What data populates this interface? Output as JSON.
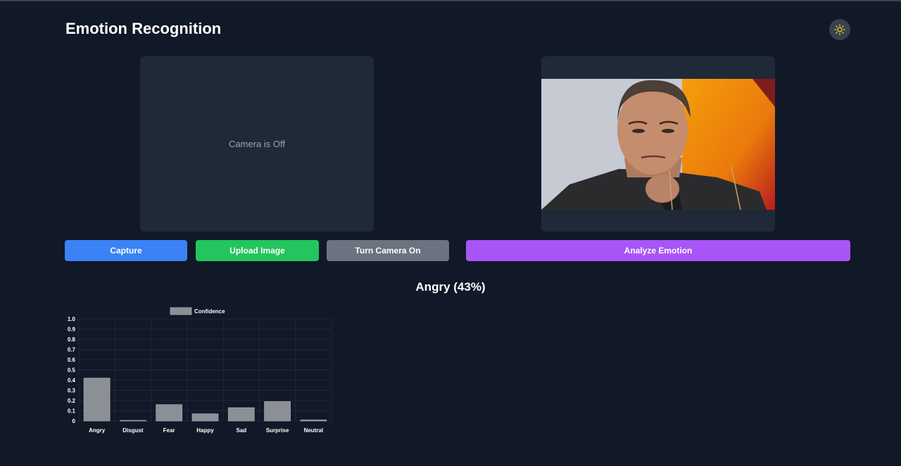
{
  "app": {
    "title": "Emotion Recognition",
    "theme_toggle_icon": "sun-icon"
  },
  "camera": {
    "status_text": "Camera is Off"
  },
  "toolbar": {
    "capture_label": "Capture",
    "upload_label": "Upload Image",
    "camera_label": "Turn Camera On",
    "analyze_label": "Analyze Emotion"
  },
  "colors": {
    "background": "#111827",
    "panel": "#1f2937",
    "capture": "#3b82f6",
    "upload": "#22c55e",
    "camera": "#6b7280",
    "analyze": "#a855f7",
    "bar": "#8b8f96"
  },
  "result": {
    "text": "Angry (43%)"
  },
  "chart_data": {
    "type": "bar",
    "categories": [
      "Angry",
      "Disgust",
      "Fear",
      "Happy",
      "Sad",
      "Surprise",
      "Neutral"
    ],
    "series": [
      {
        "name": "Confidence",
        "values": [
          0.42,
          0.0,
          0.16,
          0.07,
          0.13,
          0.19,
          0.01
        ]
      }
    ],
    "ylim": [
      0,
      1.0
    ],
    "yticks": [
      "0",
      "0.1",
      "0.2",
      "0.3",
      "0.4",
      "0.5",
      "0.6",
      "0.7",
      "0.8",
      "0.9",
      "1.0"
    ],
    "legend": "top",
    "grid": true
  }
}
